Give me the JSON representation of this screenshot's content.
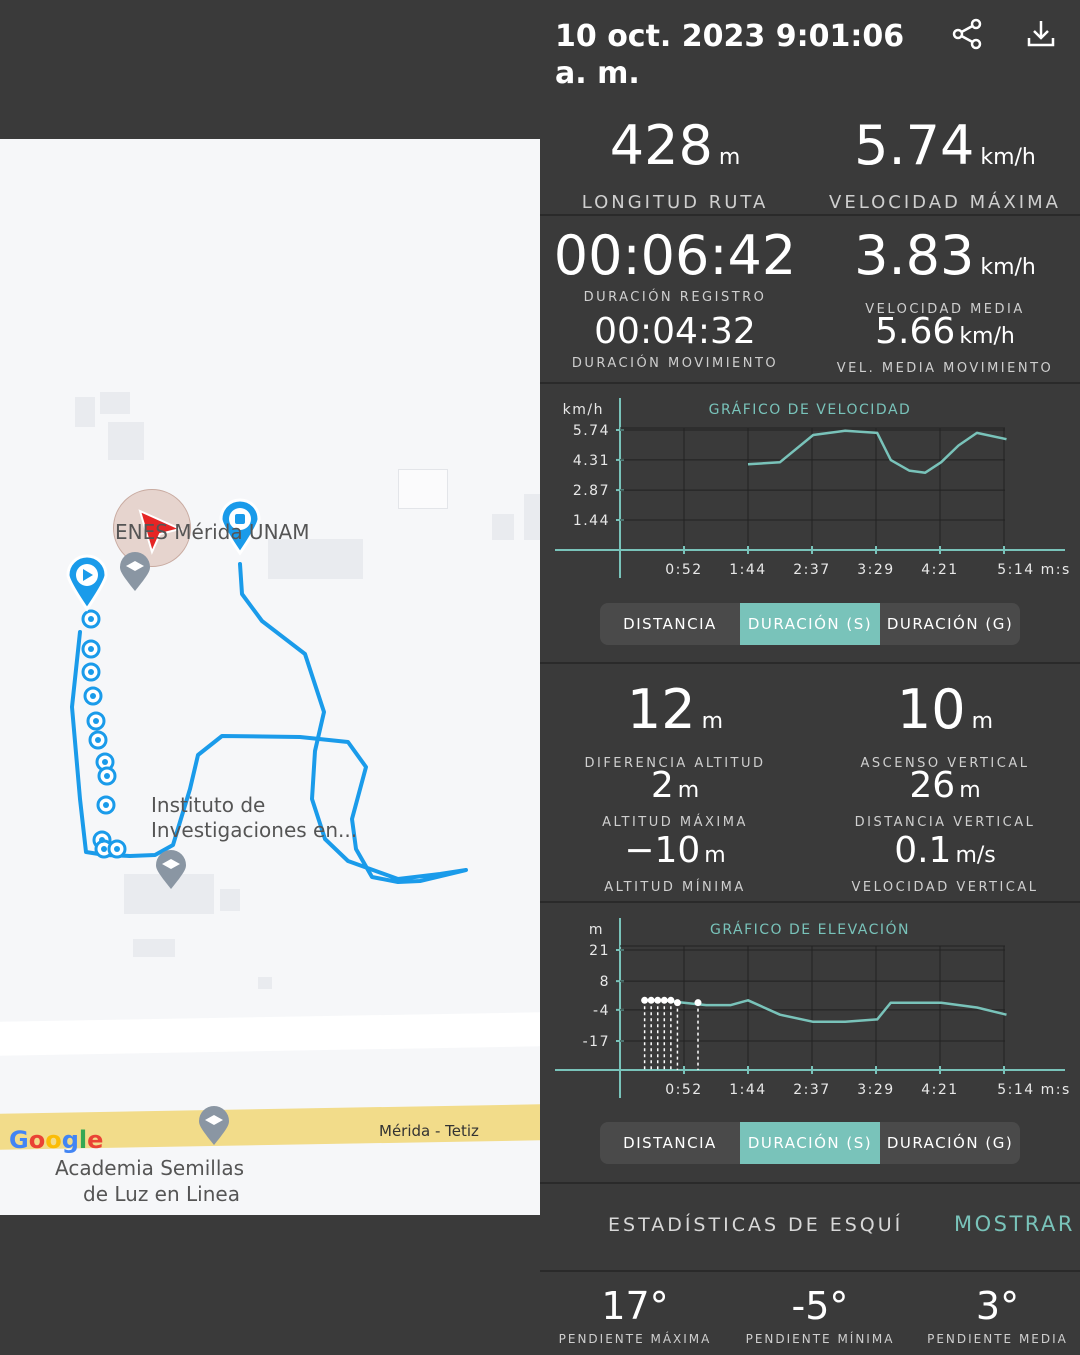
{
  "header": {
    "title": "10 oct. 2023 9:01:06 a. m.",
    "share_icon": "share-icon",
    "download_icon": "download-icon"
  },
  "map": {
    "labels": {
      "poi_top": "ENES Mérida UNAM",
      "poi_mid_line1": "Instituto de",
      "poi_mid_line2": "Investigaciones en...",
      "road": "Mérida - Tetiz",
      "poi_bottom_line1": "Academia Semillas",
      "poi_bottom_line2": "de Luz en Linea",
      "google": "Google"
    },
    "route_color": "#1a9bea",
    "road_color": "#f2dc8a"
  },
  "summary": {
    "route_length": {
      "value": "428",
      "unit": "m",
      "label": "LONGITUD RUTA"
    },
    "max_speed": {
      "value": "5.74",
      "unit": "km/h",
      "label": "VELOCIDAD MÁXIMA"
    },
    "record_duration": {
      "value": "00:06:42",
      "label": "DURACIÓN REGISTRO"
    },
    "avg_speed": {
      "value": "3.83",
      "unit": "km/h",
      "label": "VELOCIDAD MEDIA"
    },
    "move_duration": {
      "value": "00:04:32",
      "label": "DURACIÓN MOVIMIENTO"
    },
    "move_avg_speed": {
      "value": "5.66",
      "unit": "km/h",
      "label": "VEL. MEDIA MOVIMIENTO"
    }
  },
  "speed_chart": {
    "title": "GRÁFICO DE VELOCIDAD",
    "y_unit": "km/h",
    "y_ticks": [
      "5.74",
      "4.31",
      "2.87",
      "1.44"
    ],
    "x_ticks": [
      "0:52",
      "1:44",
      "2:37",
      "3:29",
      "4:21",
      "5:14"
    ],
    "x_unit": "m:s",
    "tabs": [
      "DISTANCIA",
      "DURACIÓN (S)",
      "DURACIÓN (G)"
    ],
    "active_tab": 1
  },
  "elevation": {
    "alt_diff": {
      "value": "12",
      "unit": "m",
      "label": "DIFERENCIA ALTITUD"
    },
    "vert_ascent": {
      "value": "10",
      "unit": "m",
      "label": "ASCENSO VERTICAL"
    },
    "alt_max": {
      "value": "2",
      "unit": "m",
      "label": "ALTITUD MÁXIMA"
    },
    "vert_distance": {
      "value": "26",
      "unit": "m",
      "label": "DISTANCIA VERTICAL"
    },
    "alt_min": {
      "value": "−10",
      "unit": "m",
      "label": "ALTITUD MÍNIMA"
    },
    "vert_speed": {
      "value": "0.1",
      "unit": "m/s",
      "label": "VELOCIDAD VERTICAL"
    }
  },
  "elevation_chart": {
    "title": "GRÁFICO DE ELEVACIÓN",
    "y_unit": "m",
    "y_ticks": [
      "21",
      "8",
      "-4",
      "-17"
    ],
    "x_ticks": [
      "0:52",
      "1:44",
      "2:37",
      "3:29",
      "4:21",
      "5:14"
    ],
    "x_unit": "m:s",
    "tabs": [
      "DISTANCIA",
      "DURACIÓN (S)",
      "DURACIÓN (G)"
    ],
    "active_tab": 1
  },
  "ski": {
    "title": "ESTADÍSTICAS DE ESQUÍ",
    "action": "MOSTRAR"
  },
  "slopes": {
    "max": {
      "value": "17°",
      "label": "PENDIENTE MÁXIMA"
    },
    "min": {
      "value": "-5°",
      "label": "PENDIENTE MÍNIMA"
    },
    "avg": {
      "value": "3°",
      "label": "PENDIENTE MEDIA"
    }
  },
  "chart_data": [
    {
      "type": "line",
      "title": "GRÁFICO DE VELOCIDAD",
      "ylabel": "km/h",
      "xlabel": "m:s",
      "x": [
        "1:44",
        "2:10",
        "2:37",
        "3:03",
        "3:29",
        "3:40",
        "3:55",
        "4:08",
        "4:21",
        "4:35",
        "4:50",
        "5:14"
      ],
      "series": [
        {
          "values": [
            4.1,
            4.2,
            5.5,
            5.7,
            5.6,
            4.3,
            3.8,
            3.7,
            4.2,
            5.0,
            5.6,
            5.3
          ]
        }
      ],
      "ylim": [
        0,
        6.5
      ]
    },
    {
      "type": "line",
      "title": "GRÁFICO DE ELEVACIÓN",
      "ylabel": "m",
      "xlabel": "m:s",
      "x": [
        "0:20",
        "0:35",
        "0:52",
        "1:10",
        "1:30",
        "1:44",
        "2:10",
        "2:37",
        "3:03",
        "3:29",
        "3:40",
        "4:00",
        "4:21",
        "4:50",
        "5:14"
      ],
      "series": [
        {
          "values": [
            0,
            0,
            -1,
            -2,
            -2,
            0,
            -6,
            -9,
            -9,
            -8,
            -1,
            -1,
            -1,
            -3,
            -6
          ]
        }
      ],
      "ylim": [
        -22,
        25
      ]
    }
  ]
}
